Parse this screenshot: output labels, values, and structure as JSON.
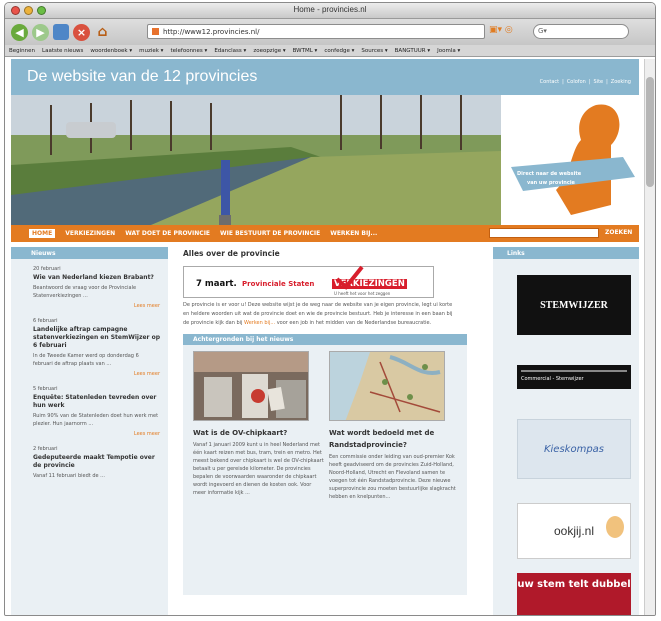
{
  "browser": {
    "title": "Home - provincies.nl",
    "url": "http://www12.provincies.nl/",
    "search_placeholder": "",
    "bookmarks": [
      "Beginnen",
      "Laatste nieuws",
      "woordenboek ▾",
      "muziek ▾",
      "telefoonnes ▾",
      "Edanclass ▾",
      "zoeopzige ▾",
      "BWTML ▾",
      "confedge ▾",
      "Sources ▾",
      "BANGTUUR ▾",
      "Joomla ▾"
    ]
  },
  "site": {
    "title": "De website van de 12 provincies",
    "toplinks": [
      "Contact",
      "Colofon",
      "Site",
      "Zoeking"
    ],
    "hero_callout": "Direct naar de website van uw provincie"
  },
  "nav": {
    "items": [
      "HOME",
      "VERKIEZINGEN",
      "WAT DOET DE PROVINCIE",
      "WIE BESTUURT DE PROVINCIE",
      "WERKEN BIJ..."
    ],
    "search_label": "ZOEKEN"
  },
  "news": {
    "heading": "Nieuws",
    "items": [
      {
        "date": "20 februari",
        "title": "Wie van Nederland kiezen Brabant?",
        "text": "Beantwoord de vraag voor de Provinciale Statenverkiezingen ..."
      },
      {
        "date": "6 februari",
        "title": "Landelijke aftrap campagne statenverkiezingen en StemWijzer op 6 februari",
        "text": "In de Tweede Kamer werd op donderdag 6 februari de aftrap plaats van ..."
      },
      {
        "date": "5 februari",
        "title": "Enquête: Statenleden tevreden over hun werk",
        "text": "Ruim 90% van de Statenleden doet hun werk met plezier. Hun jaarnorm ..."
      },
      {
        "date": "2 februari",
        "title": "Gedeputeerde maakt Tempotie over de provincie",
        "text": "Vanaf 11 februari biedt de ..."
      }
    ],
    "more_label": "Lees meer"
  },
  "main": {
    "heading": "Alles over de provincie",
    "banner": {
      "date": "7 maart.",
      "label": "Provinciale Staten",
      "label_highlight": "VERKIEZINGEN",
      "tagline": "U heeft het voor het zeggen"
    },
    "intro": "De provincie is er voor u! Deze website wijst je de weg naar de website van je eigen provincie, legt ui korte en heldere woorden uit wat de provincie doet en wie de provincie bestuurt. Heb je interesse in een baan bij de provincie kijk dan bij",
    "intro_link": "Werken bij...",
    "intro_end": "voor een job in het midden van de Nederlandse bureaucratie.",
    "background_heading": "Achtergronden bij het nieuws",
    "cards": [
      {
        "title": "Wat is de OV-chipkaart?",
        "text": "Vanaf 1 januari 2009 kunt u in heel Nederland met één kaart reizen met bus, tram, trein en metro. Het meest bekend over chipkaart is wel de OV-chipkaart betaalt u per gereisde kilometer. De provincies bepalen de voorwaarden waaronder de chipkaart wordt ingevoerd en dienen de kosten ook. Voor meer informatie kijk ..."
      },
      {
        "title": "Wat wordt bedoeld met de Randstadprovincie?",
        "text": "Een commissie onder leiding van oud-premier Kok heeft geadviseerd om de provincies Zuid-Holland, Noord-Holland, Utrecht en Flevoland samen te voegen tot één Randstadprovincie. Deze nieuwe superprovincie zou moeten bestuurlijke slagkracht hebben en knelpunten..."
      }
    ]
  },
  "links": {
    "heading": "Links",
    "items": [
      {
        "name": "StemWijzer",
        "label": "STEMWIJZER"
      },
      {
        "name": "Commercial - Stemwijzer",
        "label": "Commercial - Stemwijzer"
      },
      {
        "name": "Kieskompas",
        "label": "Kieskompas"
      },
      {
        "name": "Ookjij",
        "label": "ookjij.nl"
      },
      {
        "name": "Uw stem telt dubbel",
        "label": "uw stem telt dubbel"
      }
    ]
  },
  "colors": {
    "accent": "#e37b21",
    "header": "#8ab7cf",
    "panel": "#eaf0f4",
    "red": "#d81e2c"
  }
}
